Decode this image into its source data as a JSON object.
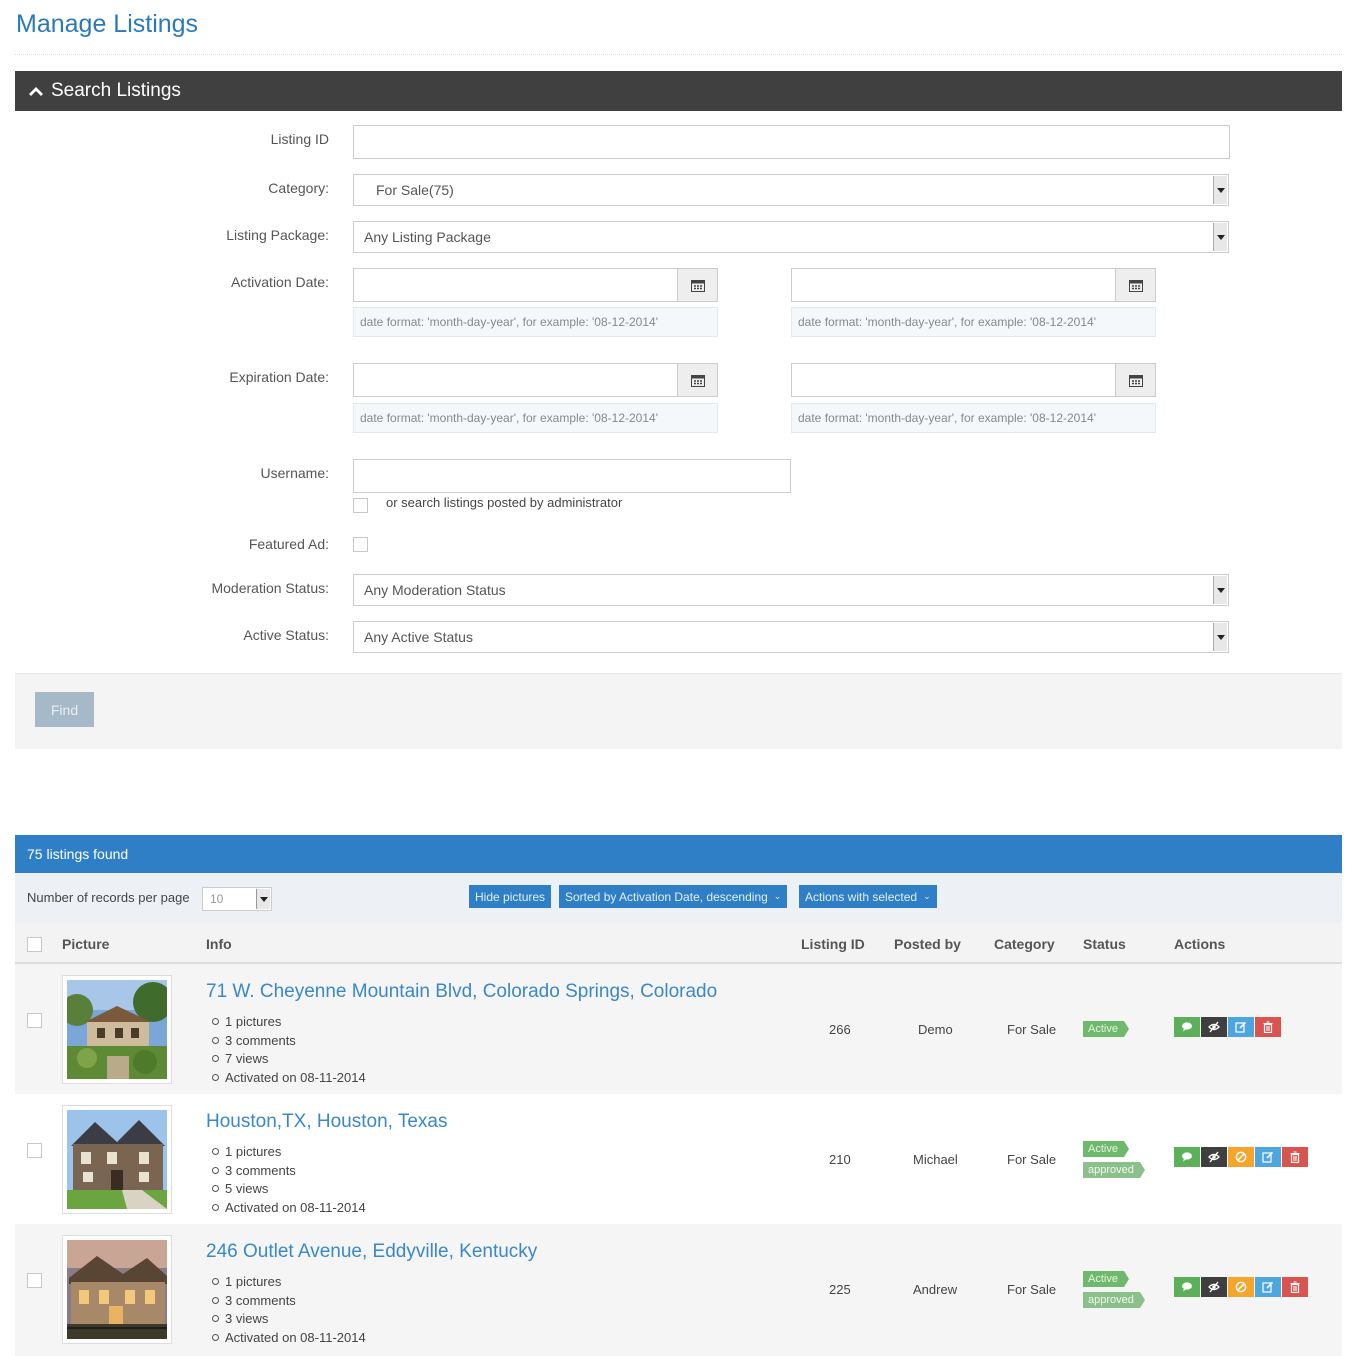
{
  "page": {
    "title": "Manage Listings"
  },
  "search": {
    "header": "Search Listings",
    "labels": {
      "listing_id": "Listing ID",
      "category": "Category:",
      "listing_package": "Listing Package:",
      "activation_date": "Activation Date:",
      "expiration_date": "Expiration Date:",
      "username": "Username:",
      "featured": "Featured Ad:",
      "moderation": "Moderation Status:",
      "active": "Active Status:"
    },
    "listing_id_value": "",
    "category_value": "For Sale(75)",
    "package_value": "Any Listing Package",
    "date_hint": "date format: 'month-day-year', for example: '08-12-2014'",
    "admin_checkbox_label": "or search listings posted by administrator",
    "moderation_value": "Any Moderation Status",
    "active_value": "Any Active Status",
    "find_label": "Find"
  },
  "results": {
    "count_text": "75 listings found",
    "rpp_label": "Number of records per page",
    "rpp_value": "10",
    "hide_pictures": "Hide pictures",
    "sorted_by": "Sorted by Activation Date, descending",
    "actions_with_selected": "Actions with selected",
    "columns": {
      "picture": "Picture",
      "info": "Info",
      "listing_id": "Listing ID",
      "posted_by": "Posted by",
      "category": "Category",
      "status": "Status",
      "actions": "Actions"
    },
    "rows": [
      {
        "title": "71 W. Cheyenne Mountain Blvd, Colorado Springs, Colorado",
        "pictures": "1 pictures",
        "comments": "3 comments",
        "views": "7 views",
        "activated": "Activated on 08-11-2014",
        "listing_id": "266",
        "posted_by": "Demo",
        "category": "For Sale",
        "status": "Active",
        "moderation": ""
      },
      {
        "title": "Houston,TX, Houston, Texas",
        "pictures": "1 pictures",
        "comments": "3 comments",
        "views": "5 views",
        "activated": "Activated on 08-11-2014",
        "listing_id": "210",
        "posted_by": "Michael",
        "category": "For Sale",
        "status": "Active",
        "moderation": "approved"
      },
      {
        "title": "246 Outlet Avenue, Eddyville, Kentucky",
        "pictures": "1 pictures",
        "comments": "3 comments",
        "views": "3 views",
        "activated": "Activated on 08-11-2014",
        "listing_id": "225",
        "posted_by": "Andrew",
        "category": "For Sale",
        "status": "Active",
        "moderation": "approved"
      }
    ]
  },
  "icons": {
    "collapse": "chevron-up-icon",
    "calendar": "calendar-icon",
    "comment": "comment-icon",
    "hide": "eye-slash-icon",
    "deactivate": "ban-icon",
    "edit": "edit-icon",
    "delete": "trash-icon"
  },
  "colors": {
    "primary": "#2f7fc6",
    "title": "#2a7ab8",
    "header_dark": "#404040",
    "active_badge": "#6eb96b",
    "danger": "#d9534f",
    "warning": "#f3a52c"
  }
}
